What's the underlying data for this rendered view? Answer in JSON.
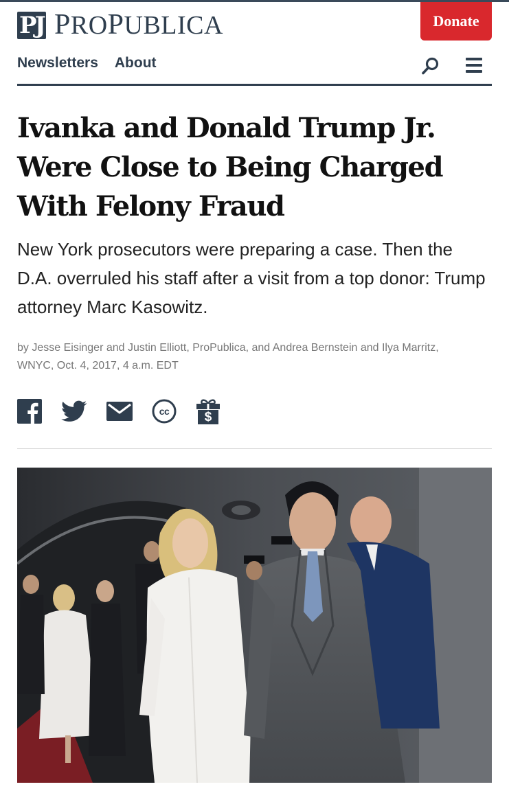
{
  "brand": {
    "name_first_big": "P",
    "name_rest_1": "RO",
    "name_big_2": "P",
    "name_rest_2": "UBLICA",
    "logo_letters": "PJ"
  },
  "header": {
    "donate_label": "Donate"
  },
  "nav": {
    "items": [
      {
        "label": "Newsletters"
      },
      {
        "label": "About"
      }
    ],
    "search_icon": "search-icon",
    "menu_icon": "hamburger-menu-icon"
  },
  "article": {
    "headline": "Ivanka and Donald Trump Jr. Were Close to Being Charged With Felony Fraud",
    "dek": "New York prosecutors were preparing a case. Then the D.A. overruled his staff after a visit from a top donor: Trump attorney Marc Kasowitz.",
    "byline": "by Jesse Eisinger and Justin Elliott, ProPublica, and Andrea Bernstein and Ilya Marritz, WNYC, Oct. 4, 2017, 4 a.m. EDT"
  },
  "share": {
    "icons": [
      "facebook-icon",
      "twitter-icon",
      "email-icon",
      "creative-commons-icon",
      "donate-gift-icon"
    ],
    "cc_text": "cc",
    "gift_text": "$"
  },
  "colors": {
    "brand_navy": "#2f3e4e",
    "donate_red": "#d9282d",
    "byline_gray": "#777777"
  }
}
